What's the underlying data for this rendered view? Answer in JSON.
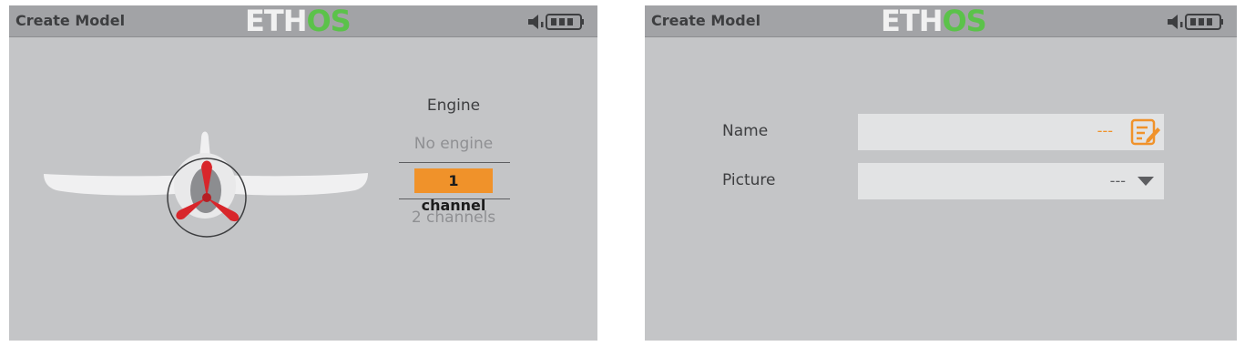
{
  "left_screen": {
    "title": "Create Model",
    "logo": {
      "eth": "ETH",
      "os": "OS"
    },
    "menu": {
      "heading": "Engine",
      "options": [
        "No engine",
        "1 channel",
        "2 channels"
      ],
      "selected": "1 channel"
    }
  },
  "right_screen": {
    "title": "Create Model",
    "logo": {
      "eth": "ETH",
      "os": "OS"
    },
    "name_field": {
      "label": "Name",
      "value": "---"
    },
    "picture_field": {
      "label": "Picture",
      "value": "---"
    }
  },
  "colors": {
    "screen_bg": "#c4c5c7",
    "titlebar_bg": "#a2a3a6",
    "accent_orange": "#f0922a",
    "logo_green": "#5bc24a",
    "propeller_red": "#d8262b"
  },
  "icons": [
    "volume-icon",
    "battery-icon",
    "edit-icon",
    "dropdown-arrow-icon",
    "airplane-icon"
  ]
}
